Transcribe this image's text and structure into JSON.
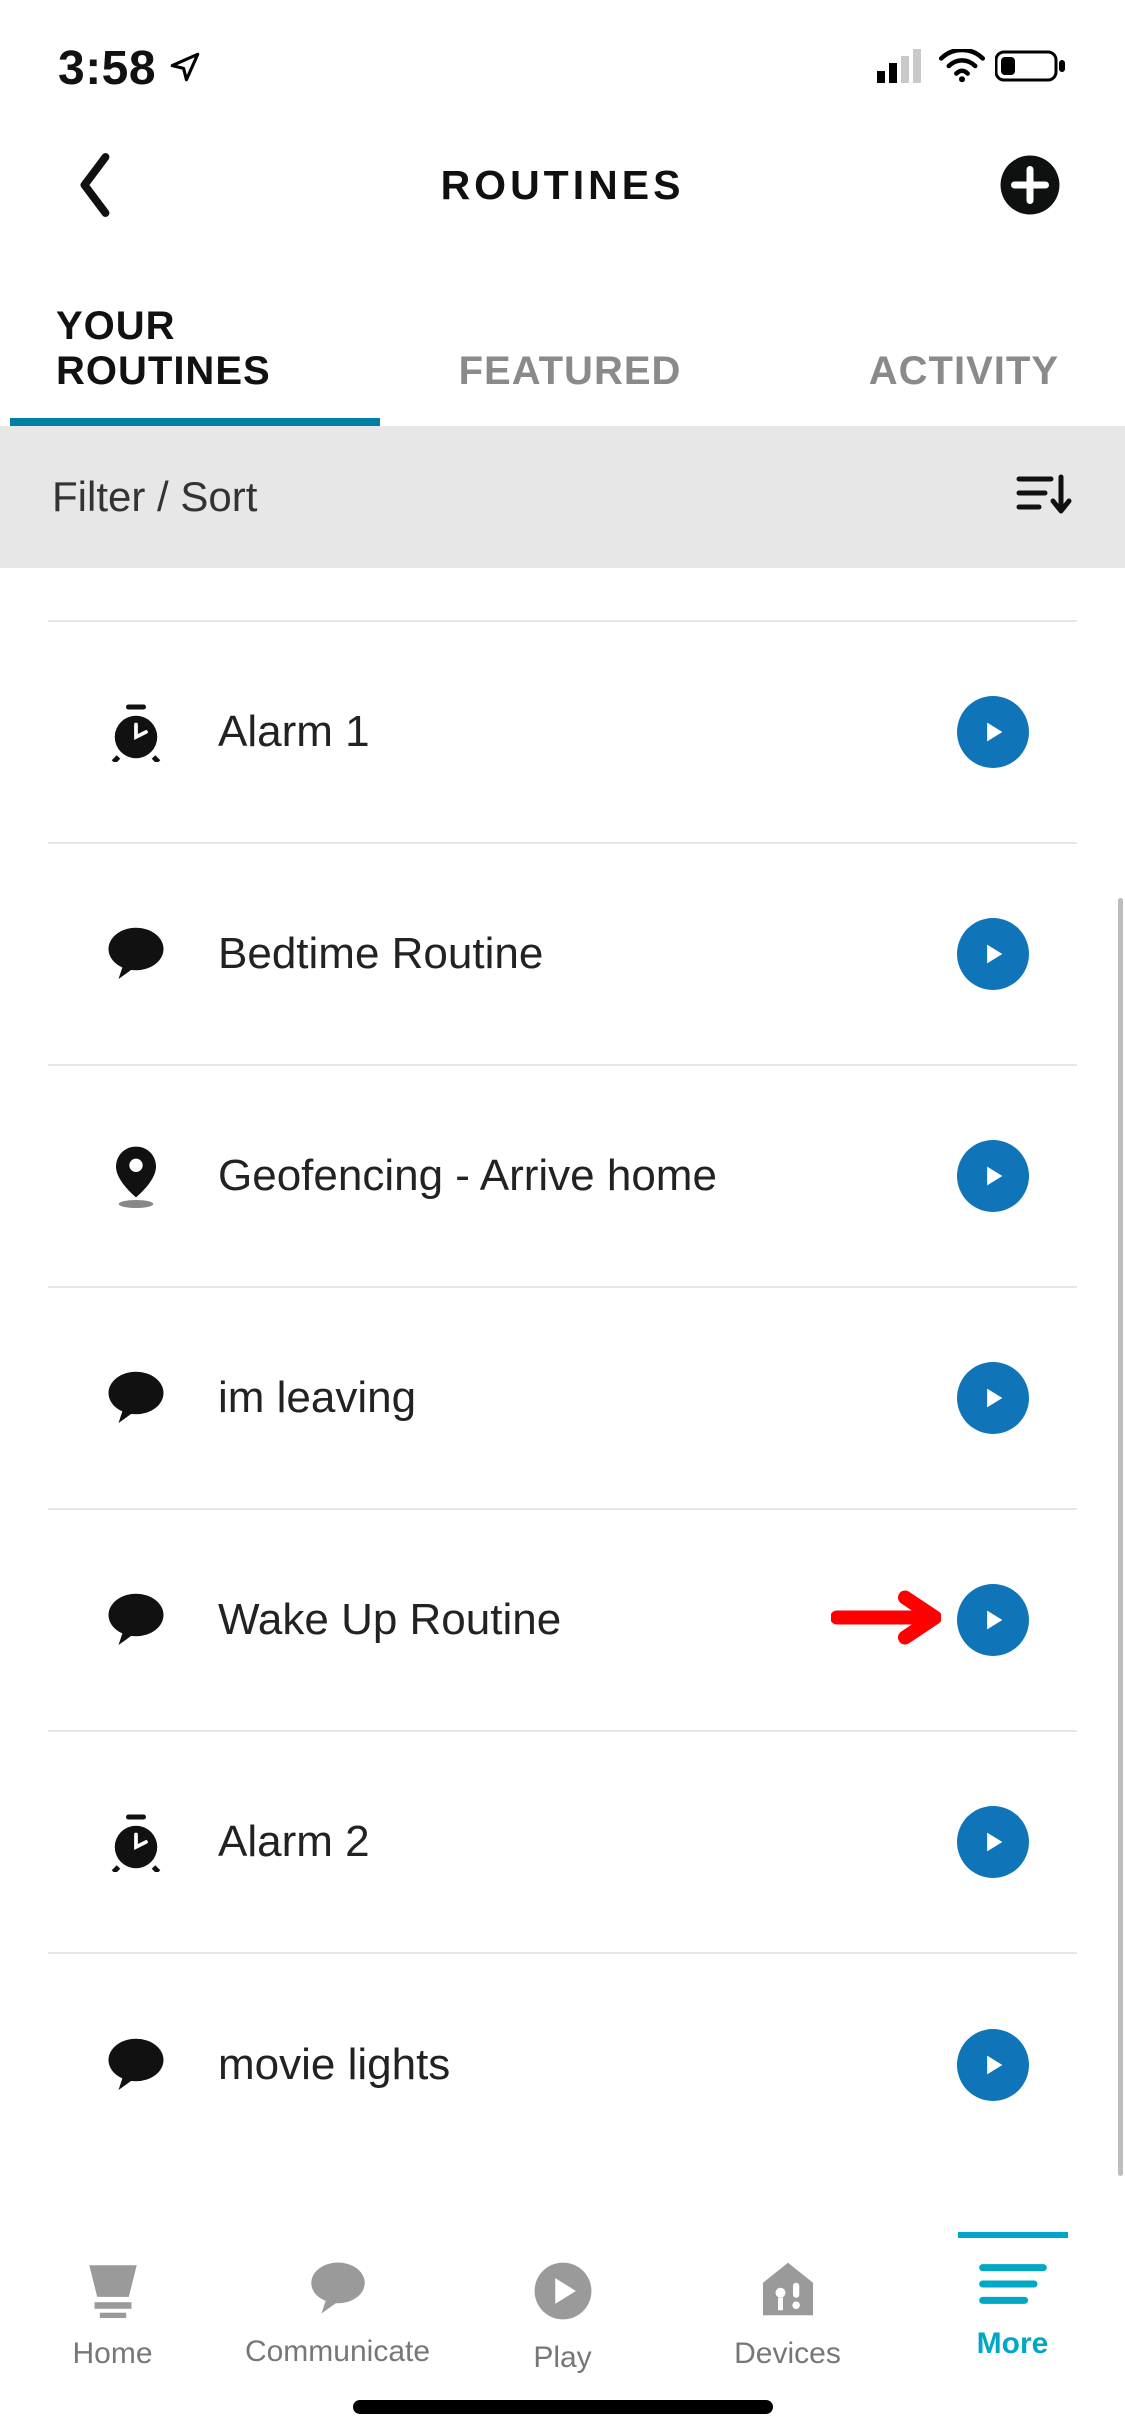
{
  "status": {
    "time": "3:58"
  },
  "header": {
    "title": "ROUTINES"
  },
  "tabs": [
    {
      "label": "YOUR ROUTINES",
      "active": true
    },
    {
      "label": "FEATURED",
      "active": false
    },
    {
      "label": "ACTIVITY",
      "active": false
    }
  ],
  "filter": {
    "label": "Filter / Sort"
  },
  "routines": [
    {
      "icon": "alarm",
      "label": "Alarm 1"
    },
    {
      "icon": "speech",
      "label": "Bedtime Routine"
    },
    {
      "icon": "location",
      "label": "Geofencing - Arrive home"
    },
    {
      "icon": "speech",
      "label": "im leaving"
    },
    {
      "icon": "speech",
      "label": "Wake Up Routine",
      "annotated": true
    },
    {
      "icon": "alarm",
      "label": "Alarm 2"
    },
    {
      "icon": "speech",
      "label": "movie lights"
    }
  ],
  "nav": [
    {
      "label": "Home",
      "icon": "home",
      "active": false
    },
    {
      "label": "Communicate",
      "icon": "speech",
      "active": false
    },
    {
      "label": "Play",
      "icon": "play",
      "active": false
    },
    {
      "label": "Devices",
      "icon": "devices",
      "active": false
    },
    {
      "label": "More",
      "icon": "more",
      "active": true
    }
  ],
  "colors": {
    "accent": "#0f75b8",
    "tabUnderline": "#007fa3",
    "navActive": "#00a8c6"
  }
}
